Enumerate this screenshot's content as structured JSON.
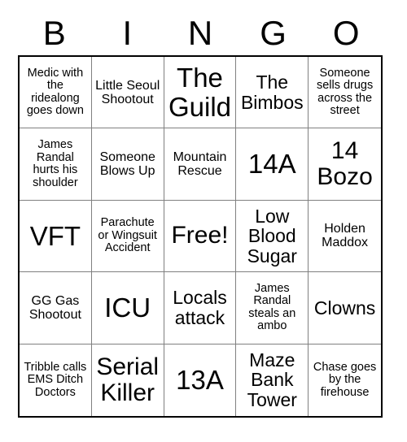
{
  "header": {
    "letters": [
      "B",
      "I",
      "N",
      "G",
      "O"
    ]
  },
  "grid": {
    "columns": 5,
    "rows": 5,
    "cells": [
      {
        "text": "Medic with the ridealong goes down",
        "size": "xs"
      },
      {
        "text": "Little Seoul Shootout",
        "size": "sm"
      },
      {
        "text": "The Guild",
        "size": "xl"
      },
      {
        "text": "The Bimbos",
        "size": "md"
      },
      {
        "text": "Someone sells drugs across the street",
        "size": "xs"
      },
      {
        "text": "James Randal hurts his shoulder",
        "size": "xs"
      },
      {
        "text": "Someone Blows Up",
        "size": "sm"
      },
      {
        "text": "Mountain Rescue",
        "size": "sm"
      },
      {
        "text": "14A",
        "size": "xl"
      },
      {
        "text": "14 Bozo",
        "size": "lg"
      },
      {
        "text": "VFT",
        "size": "xl"
      },
      {
        "text": "Parachute or Wingsuit Accident",
        "size": "xs"
      },
      {
        "text": "Free!",
        "size": "lg"
      },
      {
        "text": "Low Blood Sugar",
        "size": "md"
      },
      {
        "text": "Holden Maddox",
        "size": "sm"
      },
      {
        "text": "GG Gas Shootout",
        "size": "sm"
      },
      {
        "text": "ICU",
        "size": "xl"
      },
      {
        "text": "Locals attack",
        "size": "md"
      },
      {
        "text": "James Randal steals an ambo",
        "size": "xs"
      },
      {
        "text": "Clowns",
        "size": "md"
      },
      {
        "text": "Tribble calls EMS Ditch Doctors",
        "size": "xs"
      },
      {
        "text": "Serial Killer",
        "size": "lg"
      },
      {
        "text": "13A",
        "size": "xl"
      },
      {
        "text": "Maze Bank Tower",
        "size": "md"
      },
      {
        "text": "Chase goes by the firehouse",
        "size": "xs"
      }
    ]
  },
  "colors": {
    "background": "#ffffff",
    "text": "#000000",
    "outer_border": "#000000",
    "grid_line": "#808080"
  }
}
